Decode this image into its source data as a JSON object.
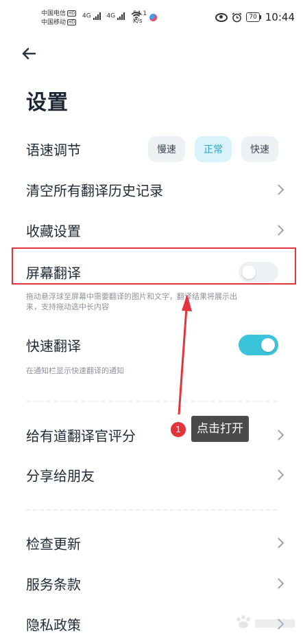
{
  "status_bar": {
    "carrier1": "中国电信",
    "carrier2": "中国移动",
    "hd_badge": "HD",
    "network": "4G",
    "speed_value": "54.1",
    "speed_unit": "K/s",
    "battery": "70",
    "time": "10:44"
  },
  "page": {
    "title": "设置"
  },
  "speech_rate": {
    "label": "语速调节",
    "options": [
      "慢速",
      "正常",
      "快速"
    ],
    "selected": "正常"
  },
  "items": {
    "clear_history": "清空所有翻译历史记录",
    "favorites": "收藏设置",
    "screen_translate": "屏幕翻译",
    "screen_translate_desc": "拖动悬浮球至屏幕中需要翻译的图片和文字，翻译结果将展示出来，支持拖动选中长内容",
    "quick_translate": "快速翻译",
    "quick_translate_desc": "在通知栏显示快速翻译的通知",
    "rate": "给有道翻译官评分",
    "share": "分享给朋友",
    "check_update": "检查更新",
    "terms": "服务条款",
    "privacy": "隐私政策"
  },
  "toggles": {
    "screen_translate": false,
    "quick_translate": true
  },
  "annotation": {
    "step": "1",
    "text": "点击打开"
  },
  "colors": {
    "accent": "#3cc3dc",
    "annotation": "#e4333d"
  }
}
